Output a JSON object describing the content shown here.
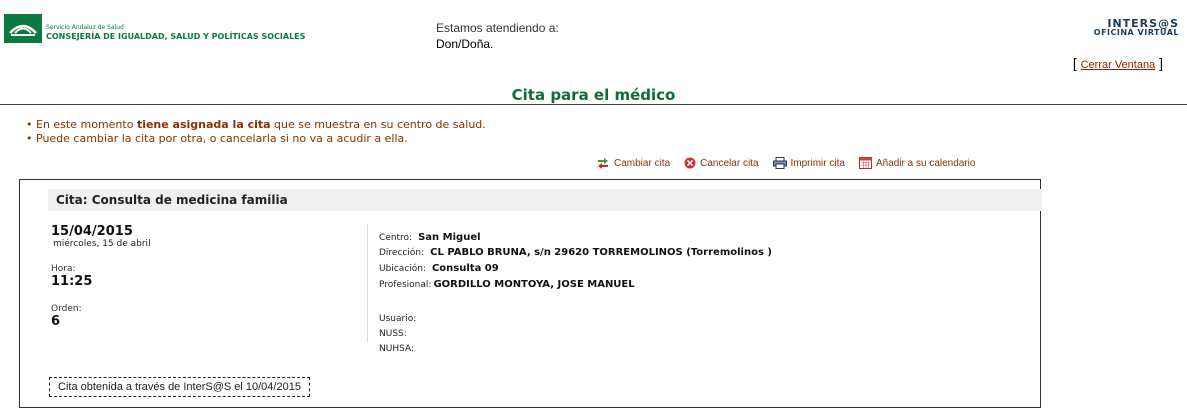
{
  "header": {
    "org_small": "Servicio Andaluz de Salud",
    "org_big": "CONSEJERÍA DE IGUALDAD, SALUD Y POLÍTICAS SOCIALES",
    "attending_label": "Estamos atendiendo a:",
    "attending_name": "Don/Doña.",
    "brand_name": "INTERS@S",
    "brand_sub": "OFICINA VIRTUAL",
    "close_label": "Cerrar Ventana"
  },
  "page_title": "Cita para el médico",
  "bullets": {
    "b1_pre": "En este momento ",
    "b1_bold": "tiene asignada la cita",
    "b1_post": " que se muestra en su centro de salud.",
    "b2": "Puede cambiar la cita por otra, o cancelarla si no va a acudir a ella."
  },
  "actions": {
    "change": "Cambiar cita",
    "cancel": "Cancelar cita",
    "print": "Imprimir cita",
    "calendar": "Añadir a su calendario"
  },
  "appointment": {
    "title": "Cita: Consulta de medicina familia",
    "date": "15/04/2015",
    "weekday": "miércoles, 15 de abril",
    "hora_label": "Hora:",
    "hora": "11:25",
    "orden_label": "Orden:",
    "orden": "6",
    "centro_label": "Centro:",
    "centro": "San Miguel",
    "direccion_label": "Dirección:",
    "direccion": "CL PABLO BRUNA, s/n 29620 TORREMOLINOS (Torremolinos )",
    "ubicacion_label": "Ubicación:",
    "ubicacion": "Consulta 09",
    "profesional_label": "Profesional:",
    "profesional": "GORDILLO MONTOYA, JOSE MANUEL",
    "usuario_label": "Usuario:",
    "nuss_label": "NUSS:",
    "nuhsa_label": "NUHSA:",
    "note": "Cita obtenida a través de InterS@S el 10/04/2015"
  },
  "colors": {
    "green": "#0b7a3e",
    "link": "#8b3200",
    "brand": "#1b3a5c"
  }
}
